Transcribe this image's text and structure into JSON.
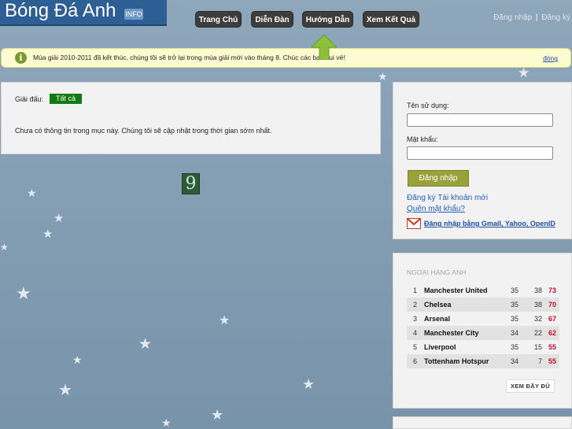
{
  "site": {
    "title": "Bóng Đá Anh",
    "badge": "INFO"
  },
  "nav": [
    {
      "label": "Trang Chủ"
    },
    {
      "label": "Diễn Đàn"
    },
    {
      "label": "Hướng Dẫn"
    },
    {
      "label": "Xem Kết Quả"
    }
  ],
  "top_links": {
    "login": "Đăng nhập",
    "separator": "|",
    "register": "Đăng ký"
  },
  "notice": {
    "icon": "info-icon",
    "text": "Mùa giải 2010-2011 đã kết thúc, chúng tôi sẽ trở lại trong mùa giải mới vào tháng 8. Chúc các bạn vui vẻ!",
    "close": "đóng"
  },
  "main": {
    "league_label": "Giải đấu:",
    "league_value": "Tất cả",
    "empty_message": "Chưa có thông tin trong mục này. Chúng tôi sẽ cập nhật trong thời gian sớm nhất.",
    "tile_glyph": "9"
  },
  "login": {
    "username_label": "Tên sử dụng:",
    "username_value": "",
    "password_label": "Mật khẩu:",
    "password_value": "",
    "submit": "Đăng nhập",
    "register_link": "Đăng ký Tài khoản mới",
    "forgot_link": "Quên mật khẩu?",
    "openid_link": "Đăng nhập bằng Gmail, Yahoo, OpenID"
  },
  "standings": {
    "title": "NGOẠI HẠNG ANH",
    "rows": [
      {
        "rank": "1",
        "team": "Manchester United",
        "played": "35",
        "gd": "38",
        "pts": "73"
      },
      {
        "rank": "2",
        "team": "Chelsea",
        "played": "35",
        "gd": "38",
        "pts": "70"
      },
      {
        "rank": "3",
        "team": "Arsenal",
        "played": "35",
        "gd": "32",
        "pts": "67"
      },
      {
        "rank": "4",
        "team": "Manchester City",
        "played": "34",
        "gd": "22",
        "pts": "62"
      },
      {
        "rank": "5",
        "team": "Liverpool",
        "played": "35",
        "gd": "15",
        "pts": "55"
      },
      {
        "rank": "6",
        "team": "Tottenham Hotspur",
        "played": "34",
        "gd": "7",
        "pts": "55"
      }
    ],
    "full_button": "XEM ĐẦY ĐỦ"
  },
  "colors": {
    "background": "#7d97ad",
    "header_blue": "#2d5f95",
    "nav_dark": "#3d3d3d",
    "notice_bg": "#fdfbd0",
    "league_tag": "#117a11",
    "login_button": "#99a23a",
    "points_red": "#c8102e",
    "arrow_green": "#8dc03a"
  }
}
